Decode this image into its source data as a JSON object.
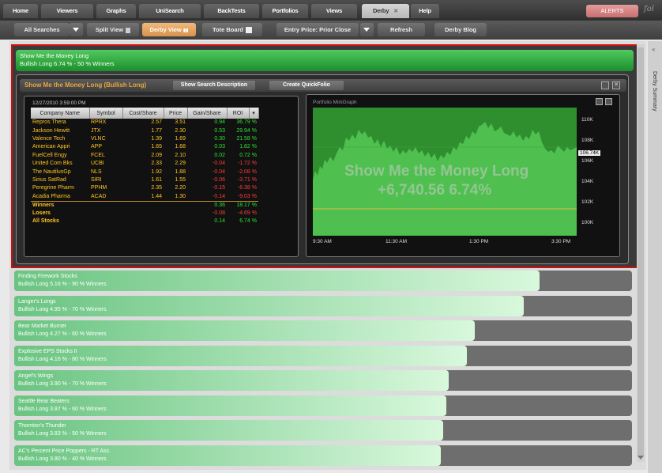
{
  "nav": {
    "tabs": [
      "Home",
      "Viewers",
      "Graphs",
      "UniSearch",
      "BackTests",
      "Portfolios",
      "Views",
      "Derby",
      "Help"
    ],
    "active_tab": "Derby",
    "alerts_label": "ALERTS",
    "logo_text": "fol"
  },
  "toolbar": {
    "all_searches": "All Searches",
    "split_view": "Split View",
    "derby_view": "Derby View",
    "tote_board": "Tote Board",
    "entry_price": "Entry Price: Prior Close",
    "refresh": "Refresh",
    "derby_blog": "Derby Blog"
  },
  "selected": {
    "name": "Show Me the Money Long",
    "summary": "Bullish Long 6.74 % - 50 % Winners",
    "panel_title": "Show Me the Money Long (Bullish Long)",
    "show_desc": "Show Search Description",
    "create_qf": "Create QuickFolio",
    "timestamp": "12/27/2010 3:59:00 PM"
  },
  "table": {
    "headers": [
      "Company Name",
      "Symbol",
      "Cost/Share",
      "Price",
      "Gain/Share",
      "ROI"
    ],
    "rows": [
      [
        "Repros Thera",
        "RPRX",
        "2.57",
        "3.51",
        "0.94",
        "36.79 %"
      ],
      [
        "Jackson Hewitt",
        "JTX",
        "1.77",
        "2.30",
        "0.53",
        "29.94 %"
      ],
      [
        "Valence Tech",
        "VLNC",
        "1.39",
        "1.69",
        "0.30",
        "21.58 %"
      ],
      [
        "American Appri",
        "APP",
        "1.65",
        "1.68",
        "0.03",
        "1.82 %"
      ],
      [
        "FuelCell Engy",
        "FCEL",
        "2.09",
        "2.10",
        "0.02",
        "0.72 %"
      ],
      [
        "United Com Bks",
        "UCBI",
        "2.33",
        "2.29",
        "-0.04",
        "-1.72 %"
      ],
      [
        "The NautilusGp",
        "NLS",
        "1.92",
        "1.88",
        "-0.04",
        "-2.08 %"
      ],
      [
        "Sirius SatRad",
        "SIRI",
        "1.61",
        "1.55",
        "-0.06",
        "-3.71 %"
      ],
      [
        "Peregrine Pharm",
        "PPHM",
        "2.35",
        "2.20",
        "-0.15",
        "-6.38 %"
      ],
      [
        "Acadia Pharma",
        "ACAD",
        "1.44",
        "1.30",
        "-0.14",
        "-9.03 %"
      ]
    ],
    "summary": [
      [
        "Winners",
        "0.36",
        "18.17 %"
      ],
      [
        "Losers",
        "-0.08",
        "-4.69 %"
      ],
      [
        "All Stocks",
        "0.14",
        "6.74 %"
      ]
    ]
  },
  "graph": {
    "title": "Portfolio MiniGraph",
    "overlay_name": "Show Me the Money Long",
    "overlay_value": "+6,740.56   6.74%",
    "current_label": "106.74K",
    "y_ticks": [
      "110K",
      "108K",
      "106K",
      "104K",
      "102K",
      "100K"
    ],
    "x_ticks": [
      "9:30 AM",
      "11:30 AM",
      "1:30 PM",
      "3:30 PM"
    ]
  },
  "searches": [
    {
      "name": "Finding Firework Stocks",
      "summary": "Bullish Long 5.16 % - 90 % Winners",
      "fill": 0.85
    },
    {
      "name": "Langer's Longs",
      "summary": "Bullish Long 4.95 % - 70 % Winners",
      "fill": 0.825
    },
    {
      "name": "Bear Market Burner",
      "summary": "Bullish Long 4.27 % - 60 % Winners",
      "fill": 0.745
    },
    {
      "name": "Explosive EPS Stocks II",
      "summary": "Bullish Long 4.16 % - 80 % Winners",
      "fill": 0.733
    },
    {
      "name": "Angel's Wings",
      "summary": "Bullish Long 3.90 % - 70 % Winners",
      "fill": 0.703
    },
    {
      "name": "Seattle Bear Beaters",
      "summary": "Bullish Long 3.87 % - 60 % Winners",
      "fill": 0.7
    },
    {
      "name": "Thornton's Thunder",
      "summary": "Bullish Long 3.83 % - 50 % Winners",
      "fill": 0.695
    },
    {
      "name": "AC's Percent Price Poppers - RT Asc.",
      "summary": "Bullish Long 3.80 % - 40 % Winners",
      "fill": 0.69
    }
  ],
  "sidebar_label": "Derby Summary"
}
